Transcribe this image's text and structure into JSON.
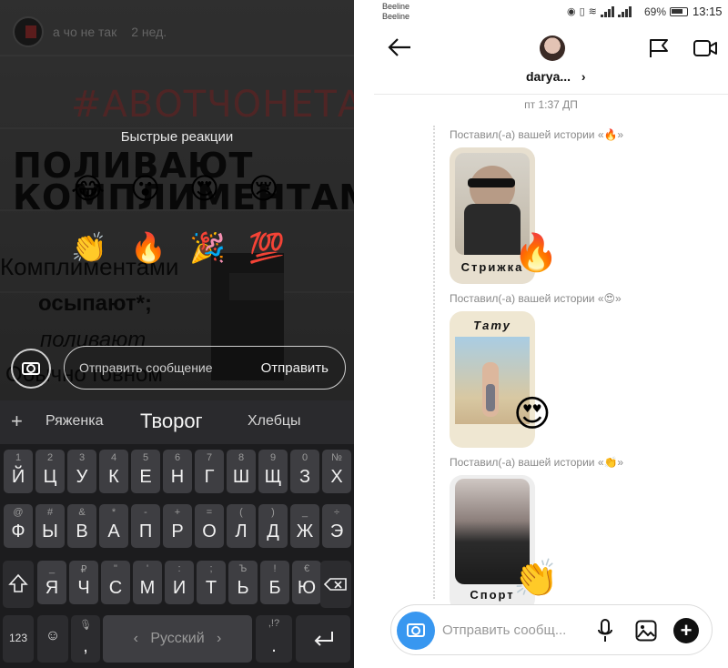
{
  "left": {
    "story": {
      "username": "а чо не так",
      "time_ago": "2 нед.",
      "hashtag": "#АВОТЧОНЕТАК",
      "text_line1": "ПОЛИВАЮТ",
      "text_line2": "КОМПЛИМЕНТАМИ",
      "text_line3": "Комплиментами",
      "text_line4": "осыпают*;",
      "text_line5": "поливают",
      "text_line6": "Обычно говном"
    },
    "quick_reactions": {
      "title": "Быстрые реакции",
      "emojis": [
        "😂",
        "😮",
        "😍",
        "😢",
        "👏",
        "🔥",
        "🎉",
        "💯"
      ]
    },
    "reply": {
      "placeholder": "Отправить сообщение",
      "send_label": "Отправить"
    },
    "suggestions": {
      "plus": "+",
      "items": [
        "Ряженка",
        "Творог",
        "Хлебцы"
      ]
    },
    "keyboard": {
      "row1": [
        {
          "main": "Й",
          "sub": "1"
        },
        {
          "main": "Ц",
          "sub": "2"
        },
        {
          "main": "У",
          "sub": "3"
        },
        {
          "main": "К",
          "sub": "4"
        },
        {
          "main": "Е",
          "sub": "5"
        },
        {
          "main": "Н",
          "sub": "6"
        },
        {
          "main": "Г",
          "sub": "7"
        },
        {
          "main": "Ш",
          "sub": "8"
        },
        {
          "main": "Щ",
          "sub": "9"
        },
        {
          "main": "З",
          "sub": "0"
        },
        {
          "main": "Х",
          "sub": "№"
        }
      ],
      "row2": [
        {
          "main": "Ф",
          "sub": "@"
        },
        {
          "main": "Ы",
          "sub": "#"
        },
        {
          "main": "В",
          "sub": "&"
        },
        {
          "main": "А",
          "sub": "*"
        },
        {
          "main": "П",
          "sub": "-"
        },
        {
          "main": "Р",
          "sub": "+"
        },
        {
          "main": "О",
          "sub": "="
        },
        {
          "main": "Л",
          "sub": "("
        },
        {
          "main": "Д",
          "sub": ")"
        },
        {
          "main": "Ж",
          "sub": "_"
        },
        {
          "main": "Э",
          "sub": "÷"
        }
      ],
      "row3": [
        {
          "main": "Я",
          "sub": "_"
        },
        {
          "main": "Ч",
          "sub": "₽"
        },
        {
          "main": "С",
          "sub": "\""
        },
        {
          "main": "М",
          "sub": "'"
        },
        {
          "main": "И",
          "sub": ":"
        },
        {
          "main": "Т",
          "sub": ";"
        },
        {
          "main": "Ь",
          "sub": "Ъ"
        },
        {
          "main": "Б",
          "sub": "!"
        },
        {
          "main": "Ю",
          "sub": "€"
        }
      ],
      "num_label": "123",
      "comma_label": ",",
      "space_label": "Русский",
      "space_left_arrow": "‹",
      "space_right_arrow": "›",
      "period_sub": ",!?",
      "period_label": "."
    }
  },
  "right": {
    "status": {
      "carrier1": "Beeline",
      "carrier2": "Beeline",
      "battery": "69%",
      "time": "13:15"
    },
    "header": {
      "username": "darya...",
      "chevron": "›"
    },
    "thread": {
      "date_label": "пт 1:37 ДП",
      "replies": [
        {
          "note": "Поставил(-а) вашей истории «🔥»",
          "card_title": "Стрижка",
          "reaction": "🔥"
        },
        {
          "note": "Поставил(-а) вашей истории «😍»",
          "card_title": "Тату",
          "reaction": "😍"
        },
        {
          "note": "Поставил(-а) вашей истории «👏»",
          "card_title": "Спорт",
          "reaction": "👏"
        }
      ]
    },
    "composer": {
      "placeholder": "Отправить сообщ...",
      "plus": "+"
    }
  }
}
